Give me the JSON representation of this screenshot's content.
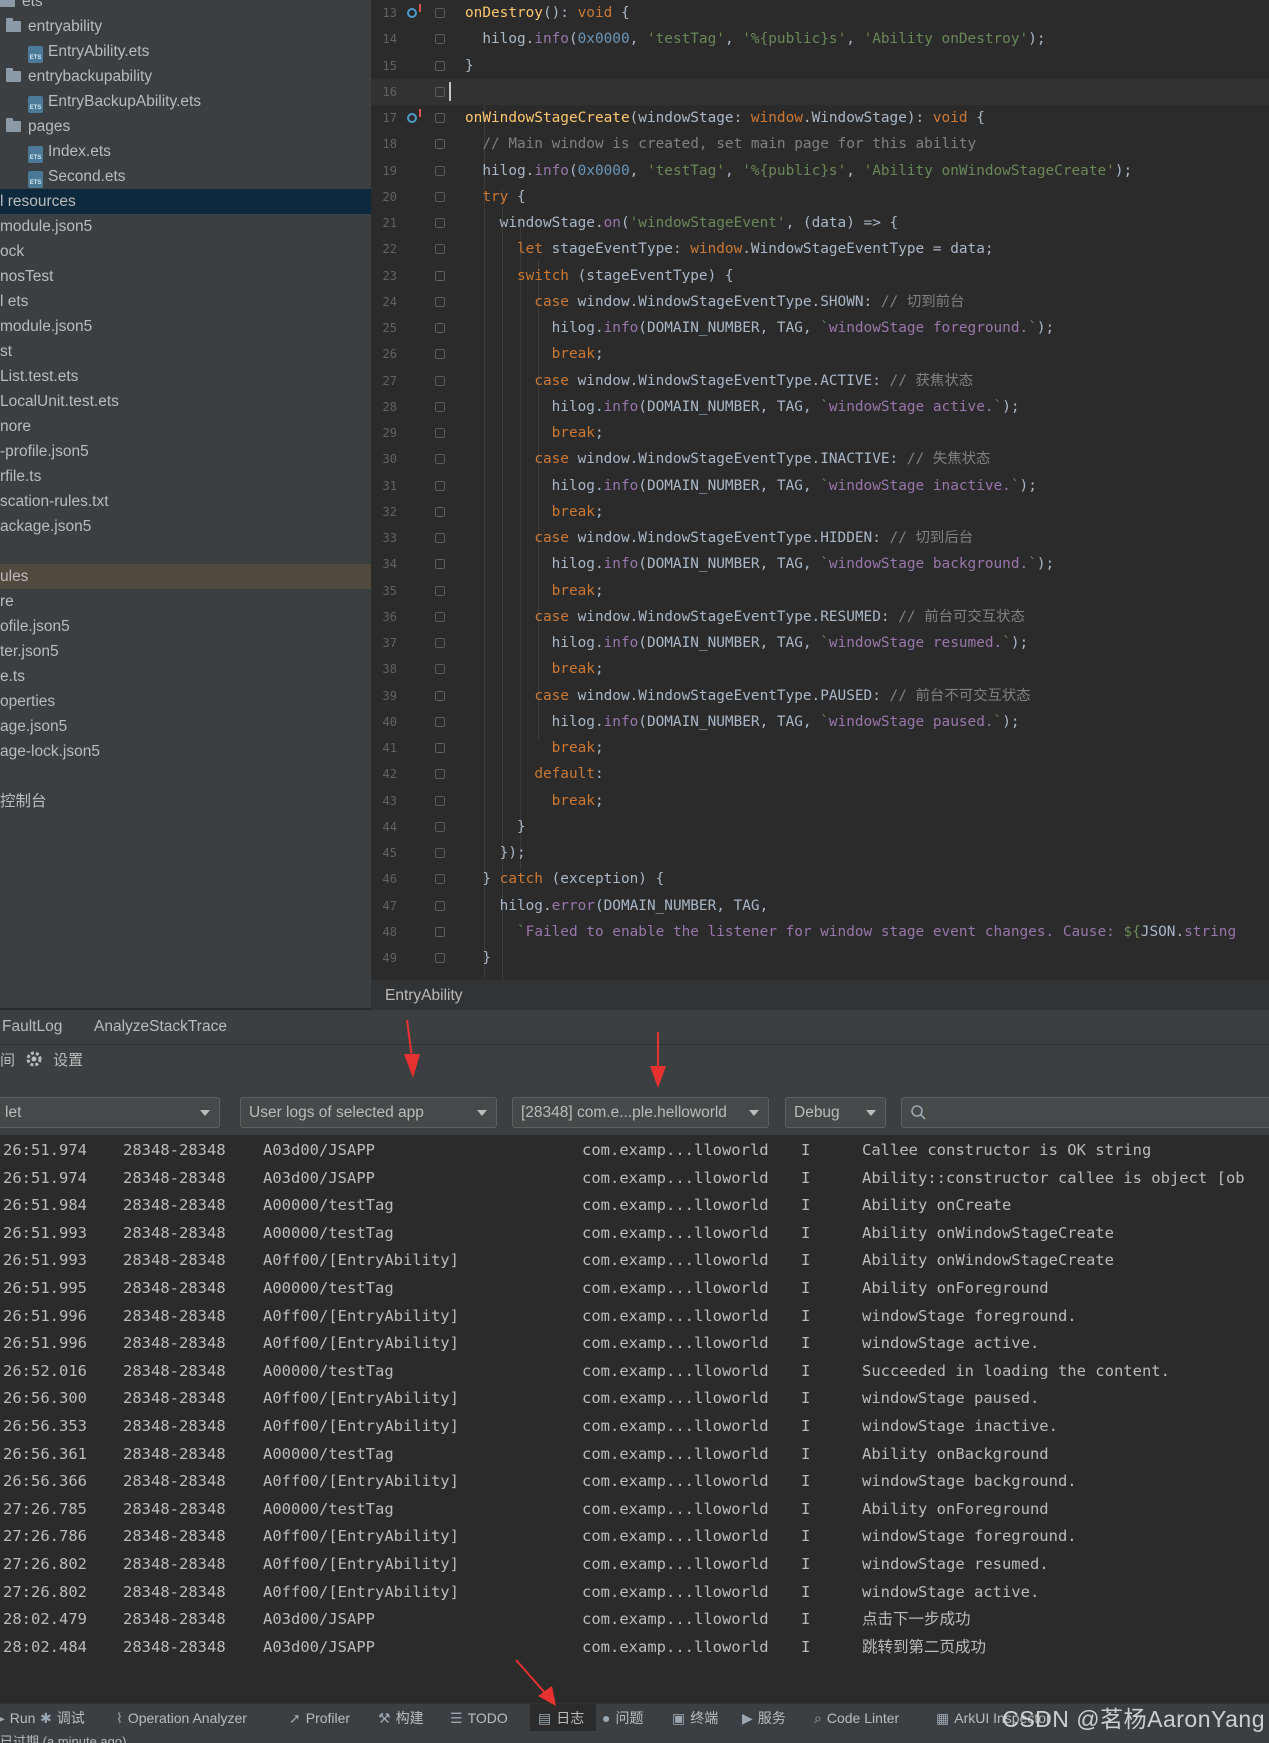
{
  "project_tree": {
    "items": [
      {
        "label": "ets",
        "icon": "folder-icon"
      },
      {
        "label": "entryability",
        "icon": "folder-icon"
      },
      {
        "label": "EntryAbility.ets",
        "icon": "ets-file-icon"
      },
      {
        "label": "entrybackupability",
        "icon": "folder-icon"
      },
      {
        "label": "EntryBackupAbility.ets",
        "icon": "ets-file-icon"
      },
      {
        "label": "pages",
        "icon": "folder-icon"
      },
      {
        "label": "Index.ets",
        "icon": "ets-file-icon"
      },
      {
        "label": "Second.ets",
        "icon": "ets-file-icon"
      },
      {
        "label": "l resources",
        "icon": "",
        "selected": true
      },
      {
        "label": "module.json5",
        "icon": ""
      },
      {
        "label": "ock",
        "icon": ""
      },
      {
        "label": "nosTest",
        "icon": ""
      },
      {
        "label": "l ets",
        "icon": ""
      },
      {
        "label": "module.json5",
        "icon": ""
      },
      {
        "label": "st",
        "icon": ""
      },
      {
        "label": "List.test.ets",
        "icon": ""
      },
      {
        "label": "LocalUnit.test.ets",
        "icon": ""
      },
      {
        "label": "nore",
        "icon": ""
      },
      {
        "label": "-profile.json5",
        "icon": ""
      },
      {
        "label": "rfile.ts",
        "icon": ""
      },
      {
        "label": "scation-rules.txt",
        "icon": ""
      },
      {
        "label": "ackage.json5",
        "icon": ""
      },
      {
        "label": "",
        "icon": ""
      },
      {
        "label": "ules",
        "icon": "",
        "highlighted": true
      },
      {
        "label": "re",
        "icon": ""
      },
      {
        "label": "ofile.json5",
        "icon": ""
      },
      {
        "label": "ter.json5",
        "icon": ""
      },
      {
        "label": "e.ts",
        "icon": ""
      },
      {
        "label": "operties",
        "icon": ""
      },
      {
        "label": "age.json5",
        "icon": ""
      },
      {
        "label": "age-lock.json5",
        "icon": ""
      },
      {
        "label": "",
        "icon": ""
      },
      {
        "label": "控制台",
        "icon": ""
      }
    ]
  },
  "editor": {
    "breadcrumb": "EntryAbility",
    "lines": [
      {
        "n": "13",
        "mark": true,
        "html": "<span class=\"fn\">onDestroy</span>(): <span class=\"kw\">void</span> {"
      },
      {
        "n": "14",
        "html": "  hilog.<span class=\"prop\">info</span>(<span class=\"num\">0x0000</span>, <span class=\"str\">'testTag'</span>, <span class=\"str\">'%{public}s'</span>, <span class=\"str\">'Ability onDestroy'</span>);"
      },
      {
        "n": "15",
        "html": "}"
      },
      {
        "n": "16",
        "html": "",
        "current": true
      },
      {
        "n": "17",
        "mark": true,
        "html": "<span class=\"fn\">onWindowStageCreate</span>(windowStage: <span class=\"kw\">window</span>.WindowStage): <span class=\"kw\">void</span> {"
      },
      {
        "n": "18",
        "html": "  <span class=\"cmt\">// Main window is created, set main page for this ability</span>"
      },
      {
        "n": "19",
        "html": "  hilog.<span class=\"prop\">info</span>(<span class=\"num\">0x0000</span>, <span class=\"str\">'testTag'</span>, <span class=\"str\">'%{public}s'</span>, <span class=\"str\">'Ability onWindowStageCreate'</span>);"
      },
      {
        "n": "20",
        "html": "  <span class=\"kw\">try</span> {"
      },
      {
        "n": "21",
        "html": "    windowStage.<span class=\"prop\">on</span>(<span class=\"str\">'windowStageEvent'</span>, (data) => {"
      },
      {
        "n": "22",
        "html": "      <span class=\"kw\">let</span> stageEventType: <span class=\"kw\">window</span>.WindowStageEventType = data;"
      },
      {
        "n": "23",
        "html": "      <span class=\"kw\">switch</span> (stageEventType) {"
      },
      {
        "n": "24",
        "html": "        <span class=\"kw\">case</span> window.WindowStageEventType.SHOWN: <span class=\"cmt\">// 切到前台</span>"
      },
      {
        "n": "25",
        "html": "          hilog.<span class=\"prop\">info</span>(DOMAIN_NUMBER, TAG, <span class=\"str\">`<span class=\"tpl\">windowStage foreground.</span>`</span>);"
      },
      {
        "n": "26",
        "html": "          <span class=\"kw\">break</span>;"
      },
      {
        "n": "27",
        "html": "        <span class=\"kw\">case</span> window.WindowStageEventType.ACTIVE: <span class=\"cmt\">// 获焦状态</span>"
      },
      {
        "n": "28",
        "html": "          hilog.<span class=\"prop\">info</span>(DOMAIN_NUMBER, TAG, <span class=\"str\">`<span class=\"tpl\">windowStage active.</span>`</span>);"
      },
      {
        "n": "29",
        "html": "          <span class=\"kw\">break</span>;"
      },
      {
        "n": "30",
        "html": "        <span class=\"kw\">case</span> window.WindowStageEventType.INACTIVE: <span class=\"cmt\">// 失焦状态</span>"
      },
      {
        "n": "31",
        "html": "          hilog.<span class=\"prop\">info</span>(DOMAIN_NUMBER, TAG, <span class=\"str\">`<span class=\"tpl\">windowStage inactive.</span>`</span>);"
      },
      {
        "n": "32",
        "html": "          <span class=\"kw\">break</span>;"
      },
      {
        "n": "33",
        "html": "        <span class=\"kw\">case</span> window.WindowStageEventType.HIDDEN: <span class=\"cmt\">// 切到后台</span>"
      },
      {
        "n": "34",
        "html": "          hilog.<span class=\"prop\">info</span>(DOMAIN_NUMBER, TAG, <span class=\"str\">`<span class=\"tpl\">windowStage background.</span>`</span>);"
      },
      {
        "n": "35",
        "html": "          <span class=\"kw\">break</span>;"
      },
      {
        "n": "36",
        "html": "        <span class=\"kw\">case</span> window.WindowStageEventType.RESUMED: <span class=\"cmt\">// 前台可交互状态</span>"
      },
      {
        "n": "37",
        "html": "          hilog.<span class=\"prop\">info</span>(DOMAIN_NUMBER, TAG, <span class=\"str\">`<span class=\"tpl\">windowStage resumed.</span>`</span>);"
      },
      {
        "n": "38",
        "html": "          <span class=\"kw\">break</span>;"
      },
      {
        "n": "39",
        "html": "        <span class=\"kw\">case</span> window.WindowStageEventType.PAUSED: <span class=\"cmt\">// 前台不可交互状态</span>"
      },
      {
        "n": "40",
        "html": "          hilog.<span class=\"prop\">info</span>(DOMAIN_NUMBER, TAG, <span class=\"str\">`<span class=\"tpl\">windowStage paused.</span>`</span>);"
      },
      {
        "n": "41",
        "html": "          <span class=\"kw\">break</span>;"
      },
      {
        "n": "42",
        "html": "        <span class=\"kw\">default</span>:"
      },
      {
        "n": "43",
        "html": "          <span class=\"kw\">break</span>;"
      },
      {
        "n": "44",
        "html": "      }"
      },
      {
        "n": "45",
        "html": "    });"
      },
      {
        "n": "46",
        "html": "  } <span class=\"kw\">catch</span> (exception) {"
      },
      {
        "n": "47",
        "html": "    hilog.<span class=\"prop\">error</span>(DOMAIN_NUMBER, TAG,"
      },
      {
        "n": "48",
        "html": "      <span class=\"str\">`<span class=\"tpl\">Failed to enable the listener for window stage event changes. Cause: </span>${</span>JSON.<span class=\"prop\">string</span>"
      },
      {
        "n": "49",
        "html": "  }"
      }
    ]
  },
  "log_panel": {
    "tabs": [
      "FaultLog",
      "AnalyzeStackTrace"
    ],
    "toolbar_left": "间",
    "settings_label": "设置",
    "filter_device": "let",
    "filter_scope": "User logs of selected app",
    "filter_process": "[28348] com.e...ple.helloworld",
    "filter_level": "Debug",
    "search_placeholder": "",
    "rows": [
      {
        "time": "26:51.974",
        "pid": "28348-28348",
        "tag": "A03d00/JSAPP",
        "pkg": "com.examp...lloworld",
        "lvl": "I",
        "msg": "Callee constructor is OK string"
      },
      {
        "time": "26:51.974",
        "pid": "28348-28348",
        "tag": "A03d00/JSAPP",
        "pkg": "com.examp...lloworld",
        "lvl": "I",
        "msg": "Ability::constructor callee is object [ob"
      },
      {
        "time": "26:51.984",
        "pid": "28348-28348",
        "tag": "A00000/testTag",
        "pkg": "com.examp...lloworld",
        "lvl": "I",
        "msg": "Ability onCreate"
      },
      {
        "time": "26:51.993",
        "pid": "28348-28348",
        "tag": "A00000/testTag",
        "pkg": "com.examp...lloworld",
        "lvl": "I",
        "msg": "Ability onWindowStageCreate"
      },
      {
        "time": "26:51.993",
        "pid": "28348-28348",
        "tag": "A0ff00/[EntryAbility]",
        "pkg": "com.examp...lloworld",
        "lvl": "I",
        "msg": "Ability onWindowStageCreate"
      },
      {
        "time": "26:51.995",
        "pid": "28348-28348",
        "tag": "A00000/testTag",
        "pkg": "com.examp...lloworld",
        "lvl": "I",
        "msg": "Ability onForeground"
      },
      {
        "time": "26:51.996",
        "pid": "28348-28348",
        "tag": "A0ff00/[EntryAbility]",
        "pkg": "com.examp...lloworld",
        "lvl": "I",
        "msg": "windowStage foreground."
      },
      {
        "time": "26:51.996",
        "pid": "28348-28348",
        "tag": "A0ff00/[EntryAbility]",
        "pkg": "com.examp...lloworld",
        "lvl": "I",
        "msg": "windowStage active."
      },
      {
        "time": "26:52.016",
        "pid": "28348-28348",
        "tag": "A00000/testTag",
        "pkg": "com.examp...lloworld",
        "lvl": "I",
        "msg": "Succeeded in loading the content."
      },
      {
        "time": "26:56.300",
        "pid": "28348-28348",
        "tag": "A0ff00/[EntryAbility]",
        "pkg": "com.examp...lloworld",
        "lvl": "I",
        "msg": "windowStage paused."
      },
      {
        "time": "26:56.353",
        "pid": "28348-28348",
        "tag": "A0ff00/[EntryAbility]",
        "pkg": "com.examp...lloworld",
        "lvl": "I",
        "msg": "windowStage inactive."
      },
      {
        "time": "26:56.361",
        "pid": "28348-28348",
        "tag": "A00000/testTag",
        "pkg": "com.examp...lloworld",
        "lvl": "I",
        "msg": "Ability onBackground"
      },
      {
        "time": "26:56.366",
        "pid": "28348-28348",
        "tag": "A0ff00/[EntryAbility]",
        "pkg": "com.examp...lloworld",
        "lvl": "I",
        "msg": "windowStage background."
      },
      {
        "time": "27:26.785",
        "pid": "28348-28348",
        "tag": "A00000/testTag",
        "pkg": "com.examp...lloworld",
        "lvl": "I",
        "msg": "Ability onForeground"
      },
      {
        "time": "27:26.786",
        "pid": "28348-28348",
        "tag": "A0ff00/[EntryAbility]",
        "pkg": "com.examp...lloworld",
        "lvl": "I",
        "msg": "windowStage foreground."
      },
      {
        "time": "27:26.802",
        "pid": "28348-28348",
        "tag": "A0ff00/[EntryAbility]",
        "pkg": "com.examp...lloworld",
        "lvl": "I",
        "msg": "windowStage resumed."
      },
      {
        "time": "27:26.802",
        "pid": "28348-28348",
        "tag": "A0ff00/[EntryAbility]",
        "pkg": "com.examp...lloworld",
        "lvl": "I",
        "msg": "windowStage active."
      },
      {
        "time": "28:02.479",
        "pid": "28348-28348",
        "tag": "A03d00/JSAPP",
        "pkg": "com.examp...lloworld",
        "lvl": "I",
        "msg": "点击下一步成功"
      },
      {
        "time": "28:02.484",
        "pid": "28348-28348",
        "tag": "A03d00/JSAPP",
        "pkg": "com.examp...lloworld",
        "lvl": "I",
        "msg": "跳转到第二页成功"
      }
    ]
  },
  "tool_windows": {
    "items": [
      {
        "label": "Run",
        "icon": "run-icon"
      },
      {
        "label": "调试",
        "icon": "debug-icon"
      },
      {
        "label": "Operation Analyzer",
        "icon": "chart-icon"
      },
      {
        "label": "Profiler",
        "icon": "profiler-icon"
      },
      {
        "label": "构建",
        "icon": "build-icon"
      },
      {
        "label": "TODO",
        "icon": "list-icon"
      },
      {
        "label": "日志",
        "icon": "log-icon",
        "active": true
      },
      {
        "label": "问题",
        "icon": "info-icon"
      },
      {
        "label": "终端",
        "icon": "terminal-icon"
      },
      {
        "label": "服务",
        "icon": "services-icon"
      },
      {
        "label": "Code Linter",
        "icon": "linter-icon"
      },
      {
        "label": "ArkUI Inspector",
        "icon": "inspector-icon"
      }
    ]
  },
  "status_bar": {
    "text": "已过期 (a minute ago)"
  },
  "watermark": "CSDN @茗杨AaronYang",
  "colors": {
    "annotation_arrow": "#e8322f",
    "selection": "#0d293e",
    "background": "#2b2b2b"
  }
}
